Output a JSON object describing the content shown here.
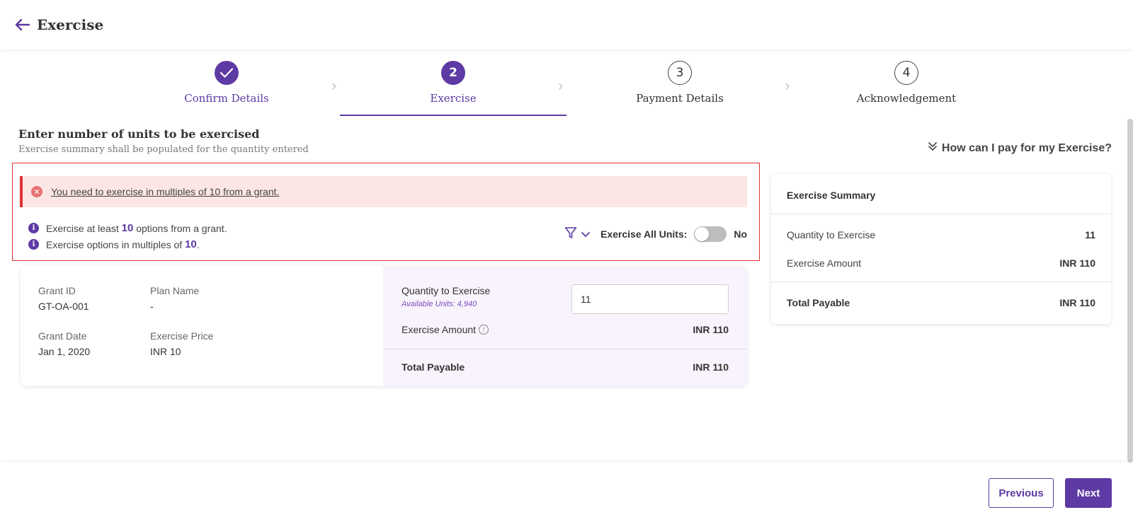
{
  "header": {
    "title": "Exercise"
  },
  "steps": [
    {
      "label": "Confirm Details",
      "state": "done"
    },
    {
      "number": "2",
      "label": "Exercise",
      "state": "active"
    },
    {
      "number": "3",
      "label": "Payment Details",
      "state": "pending"
    },
    {
      "number": "4",
      "label": "Acknowledgement",
      "state": "pending"
    }
  ],
  "section": {
    "title": "Enter number of units to be exercised",
    "subtitle": "Exercise summary shall be populated for the quantity entered"
  },
  "help_link": "How can I pay for my Exercise?",
  "alert": {
    "text": "You need to exercise in multiples of 10 from a grant."
  },
  "rules": {
    "r1_pre": "Exercise at least ",
    "r1_num": "10",
    "r1_post": " options from a grant.",
    "r2_pre": "Exercise options in multiples of ",
    "r2_num": "10",
    "r2_post": "."
  },
  "exercise_all": {
    "label": "Exercise All Units:",
    "value": "No"
  },
  "grant": {
    "grant_id_label": "Grant ID",
    "grant_id": "GT-OA-001",
    "plan_name_label": "Plan Name",
    "plan_name": "-",
    "grant_date_label": "Grant Date",
    "grant_date": "Jan 1, 2020",
    "exercise_price_label": "Exercise Price",
    "exercise_price": "INR 10",
    "quantity_label": "Quantity to Exercise",
    "available_units": "Available Units: 4,940",
    "quantity_value": "11",
    "amount_label": "Exercise Amount",
    "amount_value": "INR 110",
    "total_label": "Total Payable",
    "total_value": "INR 110"
  },
  "summary": {
    "title": "Exercise Summary",
    "qty_label": "Quantity to Exercise",
    "qty_value": "11",
    "amount_label": "Exercise Amount",
    "amount_value": "INR 110",
    "total_label": "Total Payable",
    "total_value": "INR 110"
  },
  "footer": {
    "previous": "Previous",
    "next": "Next"
  },
  "colors": {
    "brand": "#5d3aa4",
    "error": "#e03131",
    "error_bg": "#fbe6e4"
  },
  "icons": {
    "back": "arrow-left-icon",
    "done": "check-icon",
    "filter": "filter-icon",
    "help": "double-chevron-down-icon"
  }
}
